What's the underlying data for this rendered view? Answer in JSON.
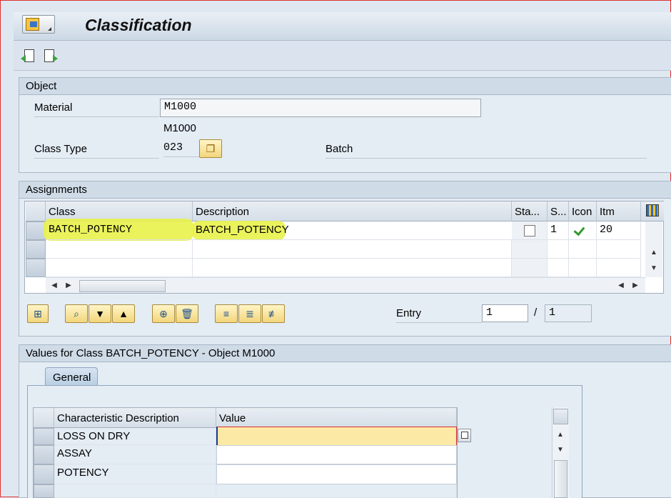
{
  "window": {
    "title": "Classification"
  },
  "toolbar": {
    "icons": [
      "previous-object-icon",
      "next-object-icon"
    ]
  },
  "object_group": {
    "title": "Object",
    "material_label": "Material",
    "material_value": "M1000",
    "material_desc": "M1000",
    "class_type_label": "Class Type",
    "class_type_value": "023",
    "class_type_text": "Batch"
  },
  "assignments": {
    "title": "Assignments",
    "columns": [
      "Class",
      "Description",
      "Sta...",
      "S...",
      "Icon",
      "Itm"
    ],
    "rows": [
      {
        "class": "BATCH_POTENCY",
        "description": "BATCH_POTENCY",
        "status_checked": false,
        "s": "1",
        "icon": "check-icon",
        "itm": "20"
      }
    ],
    "entry_label": "Entry",
    "entry_current": "1",
    "entry_sep": "/",
    "entry_total": "1"
  },
  "values": {
    "title": "Values for Class BATCH_POTENCY - Object M1000",
    "tab_label": "General",
    "columns": [
      "Characteristic Description",
      "Value"
    ],
    "rows": [
      {
        "description": "LOSS ON DRY",
        "value": ""
      },
      {
        "description": "ASSAY",
        "value": ""
      },
      {
        "description": "POTENCY",
        "value": ""
      }
    ]
  },
  "colors": {
    "highlight": "#e9f24a",
    "active_input": "#fde9a6",
    "check": "#2f9a2f"
  }
}
